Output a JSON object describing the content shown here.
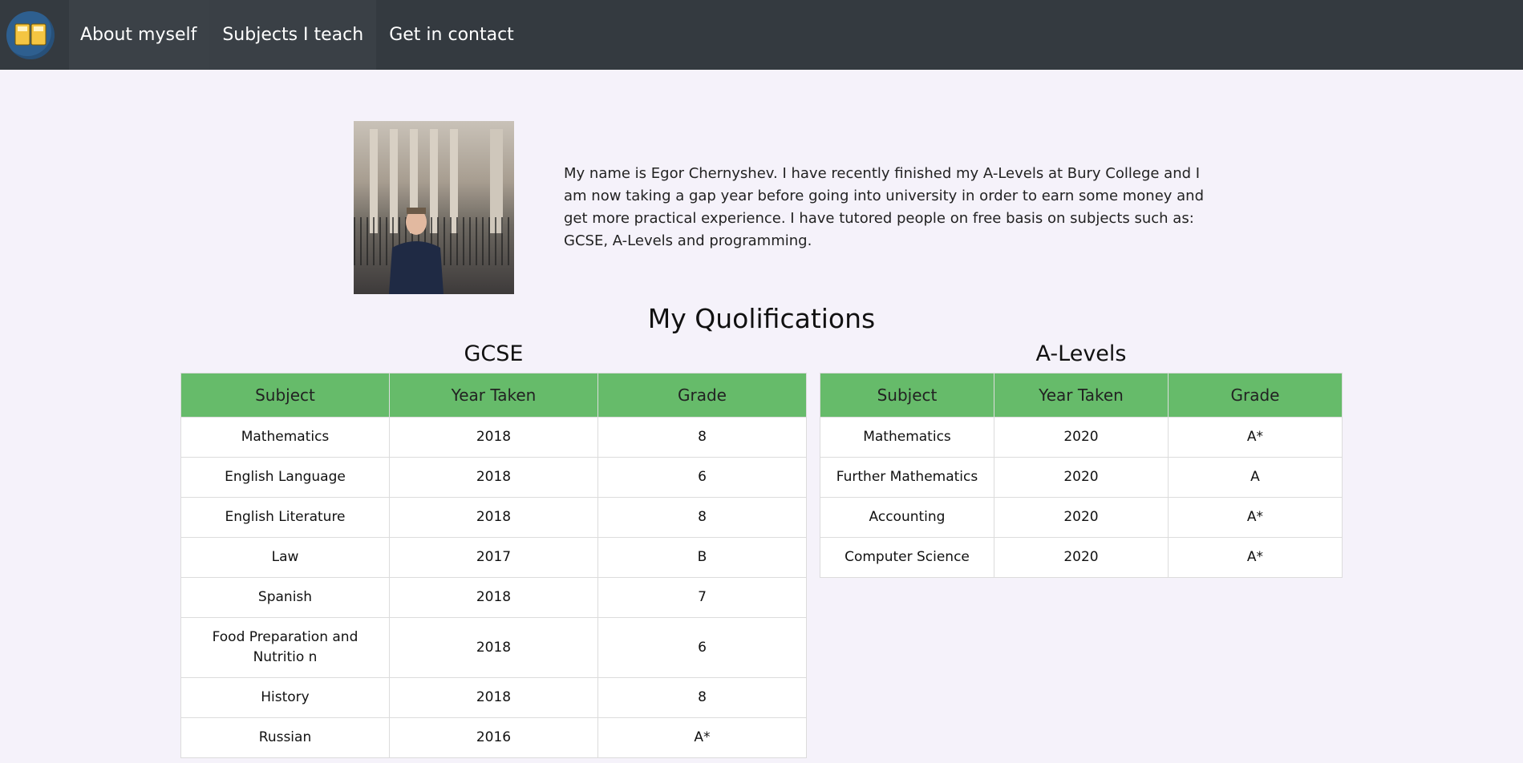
{
  "nav": {
    "items": [
      "About myself",
      "Subjects I teach",
      "Get in contact"
    ]
  },
  "intro": {
    "bio": "My name is Egor Chernyshev. I have recently finished my A-Levels at Bury College and I am now taking a gap year before going into university in order to earn some money and get more practical experience. I have tutored people on free basis on subjects such as: GCSE, A-Levels and programming."
  },
  "qualifications": {
    "title": "My Quolifications",
    "gcse": {
      "title": "GCSE",
      "headers": [
        "Subject",
        "Year Taken",
        "Grade"
      ],
      "rows": [
        [
          "Mathematics",
          "2018",
          "8"
        ],
        [
          "English Language",
          "2018",
          "6"
        ],
        [
          "English Literature",
          "2018",
          "8"
        ],
        [
          "Law",
          "2017",
          "B"
        ],
        [
          "Spanish",
          "2018",
          "7"
        ],
        [
          "Food Preparation and Nutritio n",
          "2018",
          "6"
        ],
        [
          "History",
          "2018",
          "8"
        ],
        [
          "Russian",
          "2016",
          "A*"
        ]
      ]
    },
    "alevels": {
      "title": "A-Levels",
      "headers": [
        "Subject",
        "Year Taken",
        "Grade"
      ],
      "rows": [
        [
          "Mathematics",
          "2020",
          "A*"
        ],
        [
          "Further Mathematics",
          "2020",
          "A"
        ],
        [
          "Accounting",
          "2020",
          "A*"
        ],
        [
          "Computer Science",
          "2020",
          "A*"
        ]
      ]
    }
  },
  "colors": {
    "navbar": "#343a40",
    "table_header": "#66bb6a",
    "page_background": "#f5f2fa"
  }
}
